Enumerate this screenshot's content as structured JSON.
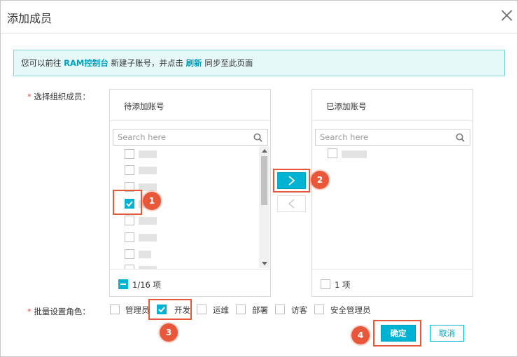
{
  "dialog": {
    "title": "添加成员"
  },
  "notice": {
    "prefix": "您可以前往",
    "link1": "RAM控制台",
    "middle": "新建子账号，并点击",
    "link2": "刷新",
    "suffix": "同步至此页面"
  },
  "form": {
    "select_members_label": "选择组织成员：",
    "batch_role_label": "批量设置角色："
  },
  "left_panel": {
    "title": "待添加账号",
    "search_placeholder": "Search here",
    "items": [
      {
        "checked": false
      },
      {
        "checked": false
      },
      {
        "checked": false
      },
      {
        "checked": true
      },
      {
        "checked": false
      },
      {
        "checked": false
      },
      {
        "checked": false
      },
      {
        "checked": false
      }
    ],
    "count": "1/16 项"
  },
  "right_panel": {
    "title": "已添加账号",
    "search_placeholder": "Search here",
    "items": [
      {
        "checked": false
      }
    ],
    "count": "1 项"
  },
  "roles": [
    {
      "label": "管理员",
      "checked": false
    },
    {
      "label": "开发",
      "checked": true
    },
    {
      "label": "运维",
      "checked": false
    },
    {
      "label": "部署",
      "checked": false
    },
    {
      "label": "访客",
      "checked": false
    },
    {
      "label": "安全管理员",
      "checked": false
    }
  ],
  "buttons": {
    "ok": "确定",
    "cancel": "取消"
  },
  "annotations": {
    "step1": "1",
    "step2": "2",
    "step3": "3",
    "step4": "4"
  },
  "colors": {
    "accent": "#00b3d2",
    "highlight": "#e8573a",
    "notice_bg": "#e6f8f8"
  }
}
